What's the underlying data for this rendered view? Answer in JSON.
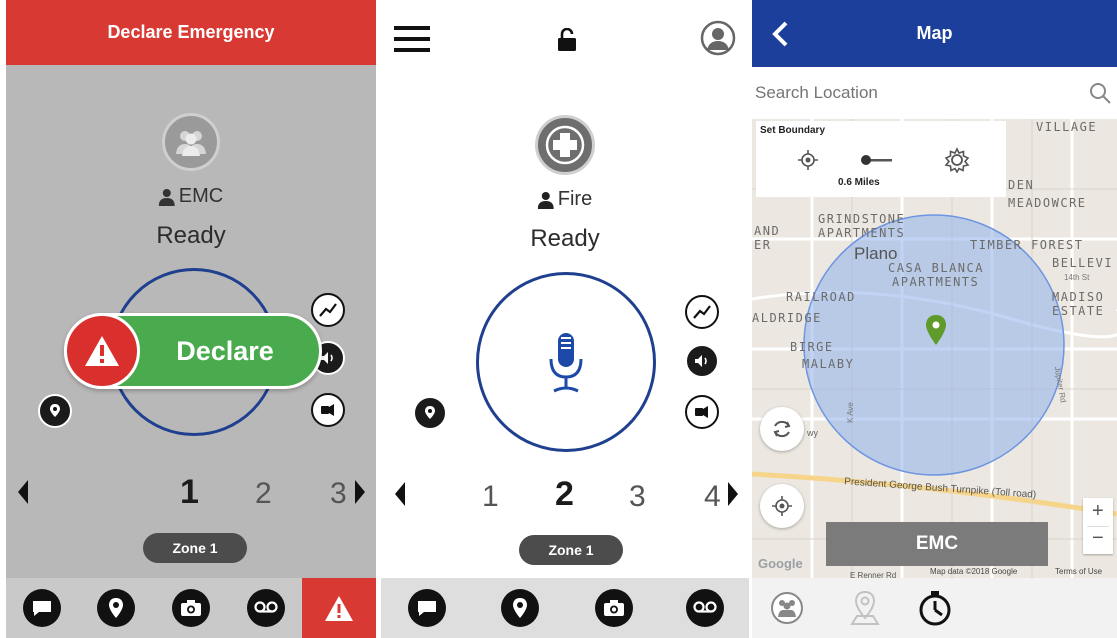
{
  "panel1": {
    "header_title": "Declare Emergency",
    "group_label": "EMC",
    "status": "Ready",
    "declare_label": "Declare",
    "zones": [
      "1",
      "2",
      "3"
    ],
    "selected_zone": "1",
    "zone_name": "Zone 1",
    "icons": {
      "group": "group-icon",
      "person": "person-icon",
      "signal": "signal-icon",
      "volume": "volume-icon",
      "speaker": "speaker-icon",
      "location_filter": "location-filter-icon",
      "warning": "warning-icon",
      "nav": [
        "message-icon",
        "location-pin-icon",
        "camera-icon",
        "voicemail-icon",
        "emergency-warning-icon"
      ]
    },
    "colors": {
      "header": "#d83a33",
      "declare": "#49ab4e",
      "warn": "#d9302e",
      "ring": "#1f3f8f"
    }
  },
  "panel2": {
    "group_label": "Fire",
    "status": "Ready",
    "zones": [
      "1",
      "2",
      "3",
      "4"
    ],
    "selected_zone": "2",
    "zone_name": "Zone 1",
    "icons": {
      "menu": "hamburger-menu-icon",
      "lock": "unlock-icon",
      "profile": "profile-icon",
      "fire_group": "medical-cross-icon",
      "mic": "microphone-icon",
      "signal": "signal-icon",
      "volume": "volume-icon",
      "speaker": "speaker-icon",
      "location_filter": "location-filter-icon",
      "nav": [
        "message-icon",
        "location-pin-icon",
        "camera-icon",
        "voicemail-icon",
        "group-icon",
        "map-pin-icon",
        "stopwatch-icon"
      ]
    }
  },
  "panel3": {
    "header_title": "Map",
    "search_placeholder": "Search Location",
    "boundary_title": "Set Boundary",
    "boundary_distance": "0.6 Miles",
    "emc_label": "EMC",
    "map_labels": {
      "village": "VILLAGE",
      "den": "DEN",
      "meadowcre": "MEADOWCRE",
      "grindstone": "GRINDSTONE",
      "apartments1": "APARTMENTS",
      "and": "AND",
      "er": "ER",
      "plano": "Plano",
      "casa_blanca": "CASA BLANCA",
      "apartments2": "APARTMENTS",
      "timber_forest": "TIMBER FOREST",
      "bellevi": "BELLEVI",
      "fourteenth": "14th St",
      "railroad": "RAILROAD",
      "madiso": "MADISO",
      "estate": "ESTATE",
      "aldridge": "ALDRIDGE",
      "birge": "BIRGE",
      "malaby": "MALABY",
      "ave_k": "K Ave",
      "jupiter": "Jupiter Rd",
      "wy": "wy",
      "turnpike": "President George Bush Turnpike (Toll road)",
      "spanner": "E Renner Rd"
    },
    "zoom_in": "+",
    "zoom_out": "−",
    "map_attribution": "Map data ©2018 Google",
    "terms": "Terms of Use",
    "google": "Google",
    "colors": {
      "header": "#1b3f9a",
      "boundary_fill": "#8fb0ec",
      "pin": "#5f9b2b",
      "emc_button": "#7b7b7b"
    }
  }
}
